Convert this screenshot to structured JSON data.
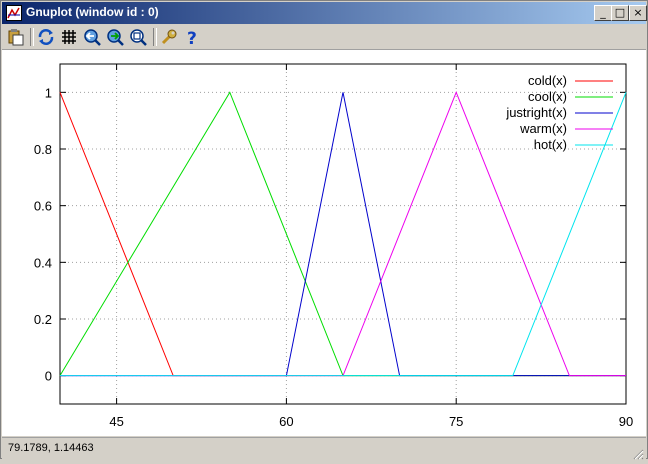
{
  "window": {
    "title": "Gnuplot (window id : 0)"
  },
  "window_buttons": {
    "minimize": "_",
    "maximize": "□",
    "close": "×"
  },
  "toolbar": {
    "items": [
      {
        "icon": "copy-to-clipboard-icon"
      },
      {
        "icon": "replot-icon"
      },
      {
        "icon": "grid-icon"
      },
      {
        "icon": "zoom-previous-icon"
      },
      {
        "icon": "zoom-next-icon"
      },
      {
        "icon": "autoscale-icon"
      },
      {
        "icon": "options-wrench-icon"
      },
      {
        "icon": "help-icon"
      }
    ]
  },
  "status": {
    "coords": "79.1789, 1.14463"
  },
  "chart_data": {
    "type": "line",
    "title": "",
    "xlabel": "",
    "ylabel": "",
    "xlim": [
      40,
      90
    ],
    "ylim": [
      -0.1,
      1.1
    ],
    "xticks": [
      45,
      60,
      75,
      90
    ],
    "yticks": [
      0,
      0.2,
      0.4,
      0.6,
      0.8,
      1
    ],
    "ytick_labels": [
      "0",
      "0.2",
      "0.4",
      "0.6",
      "0.8",
      "1"
    ],
    "grid": true,
    "legend": "top-right",
    "series": [
      {
        "name": "cold(x)",
        "color": "#ff0000",
        "x": [
          40,
          50,
          90
        ],
        "y": [
          1,
          0,
          0
        ]
      },
      {
        "name": "cool(x)",
        "color": "#00dd00",
        "x": [
          40,
          55,
          65,
          90
        ],
        "y": [
          0,
          1,
          0,
          0
        ]
      },
      {
        "name": "justright(x)",
        "color": "#0000cc",
        "x": [
          40,
          60,
          65,
          70,
          90
        ],
        "y": [
          0,
          0,
          1,
          0,
          0
        ]
      },
      {
        "name": "warm(x)",
        "color": "#ee00ee",
        "x": [
          40,
          65,
          75,
          85,
          90
        ],
        "y": [
          0,
          0,
          1,
          0,
          0
        ]
      },
      {
        "name": "hot(x)",
        "color": "#00e5ee",
        "x": [
          40,
          80,
          90
        ],
        "y": [
          0,
          0,
          1
        ]
      }
    ]
  }
}
